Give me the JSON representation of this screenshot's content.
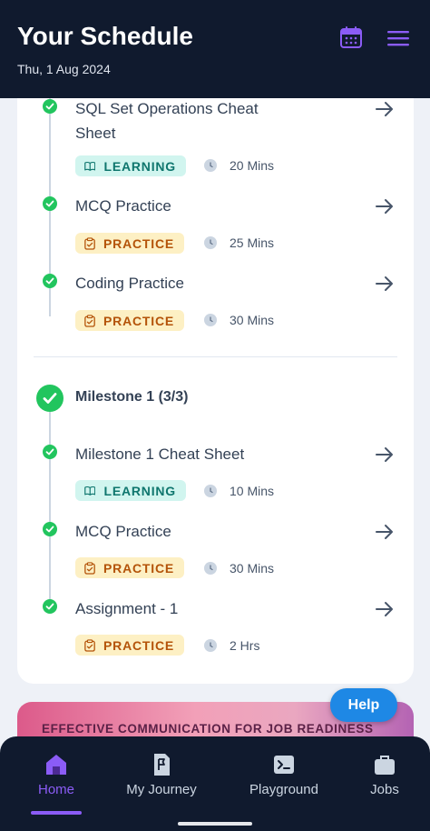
{
  "header": {
    "title": "Your Schedule",
    "date": "Thu, 1 Aug 2024",
    "calendar_icon": "calendar-icon",
    "menu_icon": "hamburger-menu-icon",
    "accent_color": "#8b5cf6"
  },
  "items_top": [
    {
      "title": "SQL Set Operations Cheat Sheet",
      "tag": "LEARNING",
      "duration": "20 Mins"
    },
    {
      "title": "MCQ Practice",
      "tag": "PRACTICE",
      "duration": "25 Mins"
    },
    {
      "title": "Coding Practice",
      "tag": "PRACTICE",
      "duration": "30 Mins"
    }
  ],
  "milestone": {
    "title": "Milestone 1 (3/3)",
    "items": [
      {
        "title": "Milestone 1 Cheat Sheet",
        "tag": "LEARNING",
        "duration": "10 Mins"
      },
      {
        "title": "MCQ Practice",
        "tag": "PRACTICE",
        "duration": "30 Mins"
      },
      {
        "title": "Assignment - 1",
        "tag": "PRACTICE",
        "duration": "2 Hrs"
      }
    ]
  },
  "banner": {
    "text": "EFFECTIVE COMMUNICATION FOR JOB READINESS"
  },
  "help": {
    "label": "Help"
  },
  "bottom_nav": [
    {
      "label": "Home",
      "icon": "home-icon",
      "active": true
    },
    {
      "label": "My Journey",
      "icon": "flag-icon",
      "active": false
    },
    {
      "label": "Playground",
      "icon": "terminal-icon",
      "active": false
    },
    {
      "label": "Jobs",
      "icon": "briefcase-icon",
      "active": false
    }
  ],
  "colors": {
    "complete": "#22c55e",
    "learning_bg": "#d1f5ef",
    "practice_bg": "#fdf0c4",
    "nav_bg": "#101a2e"
  }
}
